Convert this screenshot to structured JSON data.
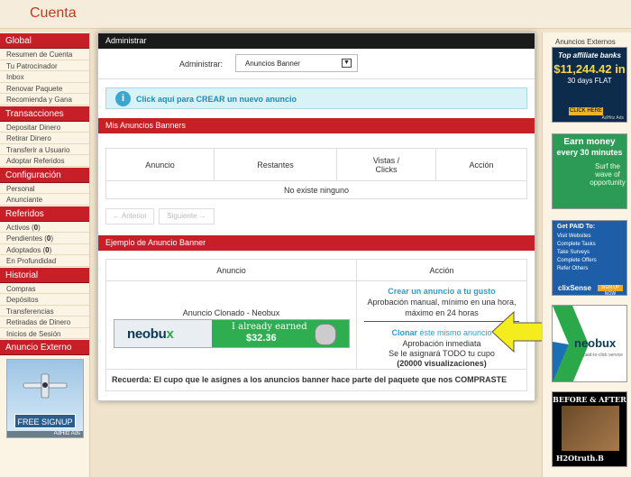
{
  "header": {
    "title": "Cuenta"
  },
  "sidebar": {
    "sections": [
      {
        "title": "Global",
        "items": [
          "Resumen de Cuenta",
          "Tu Patrocinador",
          "Inbox",
          "Renovar Paquete",
          "Recomienda y Gana"
        ]
      },
      {
        "title": "Transacciones",
        "items": [
          "Depositar Dinero",
          "Retirar Dinero",
          "Transferir a Usuario",
          "Adoptar Referidos"
        ]
      },
      {
        "title": "Configuración",
        "items": [
          "Personal",
          "Anunciante"
        ]
      },
      {
        "title": "Referidos",
        "items": [
          {
            "label": "Activos (",
            "count": "0",
            "suffix": ")"
          },
          {
            "label": "Pendientes (",
            "count": "0",
            "suffix": ")"
          },
          {
            "label": "Adoptados (",
            "count": "0",
            "suffix": ")"
          },
          {
            "label": "En Profundidad"
          }
        ]
      },
      {
        "title": "Historial",
        "items": [
          "Compras",
          "Depósitos",
          "Transferencias",
          "Retiradas de Dinero",
          "Inicios de Sesión"
        ]
      },
      {
        "title": "Anuncio Externo",
        "items": []
      }
    ],
    "ad": {
      "button": "FREE SIGNUP",
      "network": "AdHitz Ads"
    }
  },
  "main": {
    "admin_bar": "Administrar",
    "admin_label": "Administrar:",
    "admin_select": "Anuncios Banner",
    "info_text": "Click aquí para CREAR un nuevo anuncio",
    "banners_bar": "Mis Anuncios Banners",
    "banners_table": {
      "headers": [
        "Anuncio",
        "Restantes",
        "Vistas /",
        "Clicks",
        "Acción"
      ],
      "empty": "No existe ninguno"
    },
    "pager": {
      "prev": "← Anterior",
      "next": "Siguiente →"
    },
    "example_bar": "Ejemplo de Anuncio Banner",
    "example_table": {
      "headers": [
        "Anuncio",
        "Acción"
      ],
      "caption": "Anuncio Clonado - Neobux",
      "banner": {
        "logo": "neobu",
        "logo_x": "x",
        "earned": "I already earned",
        "amount": "$32.36"
      },
      "create_title": "Crear un anuncio a tu gusto",
      "create_l1": "Aprobación manual, mínimo en una hora,",
      "create_l2": "máximo en 24 horas",
      "clone_title_a": "Clonar",
      "clone_title_b": " éste mismo anuncio",
      "clone_l1": "Aprobación inmediata",
      "clone_l2": "Se le asignará TODO tu cupo",
      "clone_l3": "(20000 visualizaciones)",
      "footer": "Recuerda: El cupo que le asignes a los anuncios banner hace parte del paquete que nos COMPRASTE"
    }
  },
  "right": {
    "title": "Anuncios Externos",
    "ad1": {
      "l1": "Top affiliate banks",
      "l2": "$11,244.42 in",
      "l3": "30 days FLAT",
      "btn": "CLICK HERE",
      "net": "AdHitz Ads"
    },
    "ad2": {
      "l1": "Earn money",
      "l2": "every 30 minutes",
      "l3": "Surf the wave of opportunity"
    },
    "ad3": {
      "l1": "Get PAID To:",
      "items": [
        "Visit Websites",
        "Complete Tasks",
        "Take Surveys",
        "Complete Offers",
        "Refer Others"
      ],
      "brand": "clixSense",
      "btn": "SIGN UP NOW"
    },
    "ad4": {
      "brand": "neobux",
      "sub": "paid-to-click service"
    },
    "ad5": {
      "l1": "BEFORE & AFTER",
      "l2": "H2Otruth.B"
    }
  },
  "colors": {
    "accent_red": "#c71f27",
    "link_blue": "#2aa0c8",
    "header_text": "#c23a1f"
  }
}
